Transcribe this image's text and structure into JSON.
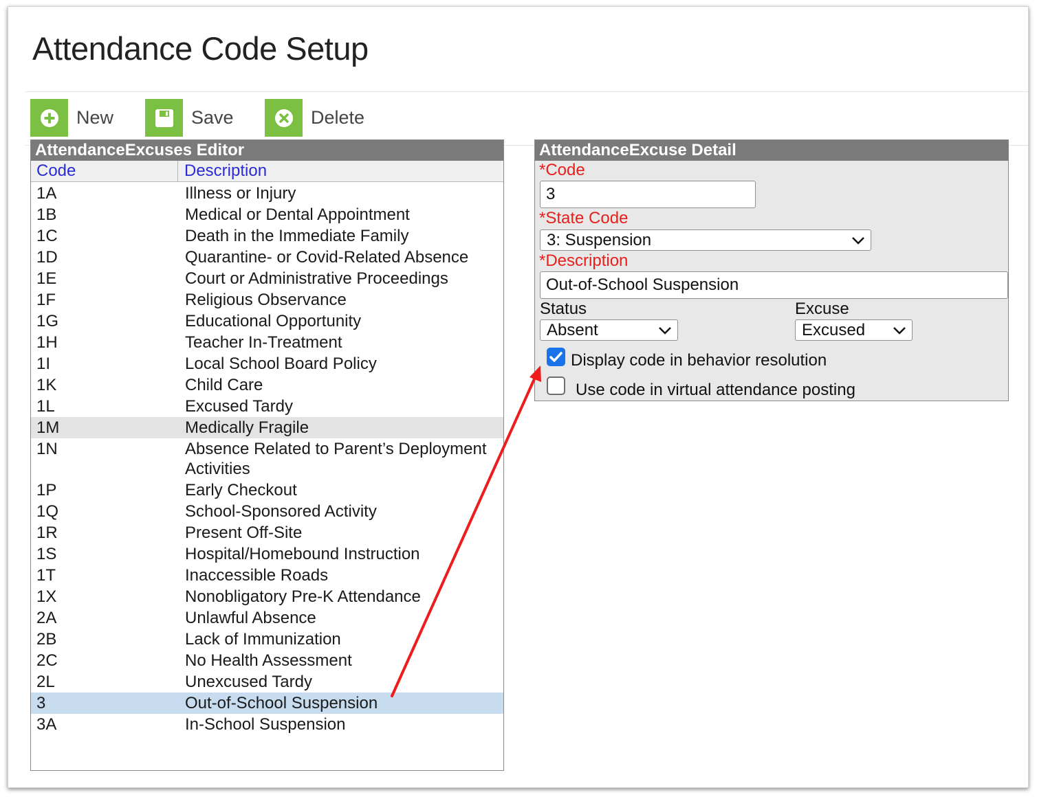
{
  "page": {
    "title": "Attendance Code Setup"
  },
  "toolbar": {
    "new_label": "New",
    "save_label": "Save",
    "delete_label": "Delete",
    "accent_color": "#7cc043"
  },
  "editor": {
    "title": "AttendanceExcuses Editor",
    "columns": {
      "code": "Code",
      "description": "Description"
    },
    "rows": [
      {
        "code": "1A",
        "description": "Illness or Injury"
      },
      {
        "code": "1B",
        "description": "Medical or Dental Appointment"
      },
      {
        "code": "1C",
        "description": "Death in the Immediate Family"
      },
      {
        "code": "1D",
        "description": "Quarantine- or Covid-Related Absence"
      },
      {
        "code": "1E",
        "description": "Court or Administrative Proceedings"
      },
      {
        "code": "1F",
        "description": "Religious Observance"
      },
      {
        "code": "1G",
        "description": "Educational Opportunity"
      },
      {
        "code": "1H",
        "description": "Teacher In-Treatment"
      },
      {
        "code": "1I",
        "description": "Local School Board Policy"
      },
      {
        "code": "1K",
        "description": "Child Care"
      },
      {
        "code": "1L",
        "description": "Excused Tardy"
      },
      {
        "code": "1M",
        "description": "Medically Fragile"
      },
      {
        "code": "1N",
        "description": "Absence Related to Parent’s Deployment Activities"
      },
      {
        "code": "1P",
        "description": "Early Checkout"
      },
      {
        "code": "1Q",
        "description": "School-Sponsored Activity"
      },
      {
        "code": "1R",
        "description": "Present Off-Site"
      },
      {
        "code": "1S",
        "description": "Hospital/Homebound Instruction"
      },
      {
        "code": "1T",
        "description": "Inaccessible Roads"
      },
      {
        "code": "1X",
        "description": "Nonobligatory Pre-K Attendance"
      },
      {
        "code": "2A",
        "description": "Unlawful Absence"
      },
      {
        "code": "2B",
        "description": "Lack of Immunization"
      },
      {
        "code": "2C",
        "description": "No Health Assessment"
      },
      {
        "code": "2L",
        "description": "Unexcused Tardy"
      },
      {
        "code": "3",
        "description": "Out-of-School Suspension"
      },
      {
        "code": "3A",
        "description": "In-School Suspension"
      }
    ],
    "hover_row_code": "1M",
    "selected_row_code": "3"
  },
  "detail": {
    "title": "AttendanceExcuse Detail",
    "code_label": "*Code",
    "code_value": "3",
    "state_code_label": "*State Code",
    "state_code_value": "3: Suspension",
    "description_label": "*Description",
    "description_value": "Out-of-School Suspension",
    "status_label": "Status",
    "status_value": "Absent",
    "excuse_label": "Excuse",
    "excuse_value": "Excused",
    "behavior_label": "Display code in behavior resolution",
    "behavior_checked": true,
    "virtual_label": "Use code in virtual attendance posting",
    "virtual_checked": false
  },
  "colors": {
    "required_label": "#e8201c",
    "column_header_text": "#2b2bd6",
    "panel_header_bg": "#7a7a7a",
    "selected_row_bg": "#c7dcee",
    "annotation_arrow": "#ee1c1c"
  }
}
